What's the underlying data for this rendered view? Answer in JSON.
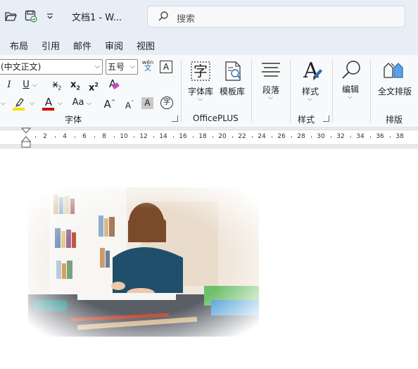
{
  "window": {
    "title": "文档1 - W...",
    "search_placeholder": "搜索"
  },
  "quick_access": [
    {
      "icon": "open-folder-icon"
    },
    {
      "icon": "save-sync-icon"
    },
    {
      "icon": "customize-dropdown-icon"
    }
  ],
  "tabs": [
    "布局",
    "引用",
    "邮件",
    "审阅",
    "视图"
  ],
  "font_group": {
    "font_name": "(中文正文)",
    "font_size": "五号",
    "phonetic_top": "wén",
    "phonetic_bottom": "文",
    "border_char": "A",
    "italic": "I",
    "underline": "U",
    "subscript": "x",
    "subscript_sub": "2",
    "superscript": "x",
    "superscript_sup": "2",
    "clear_format": "A",
    "font_color": "A",
    "change_case": "Aa",
    "grow_font": "A",
    "shrink_font": "A",
    "shading": "A",
    "enclose_char": "字",
    "label": "字体",
    "highlight_color": "#f2e400",
    "font_color_bar": "#d40000"
  },
  "officeplus_group": {
    "buttons": [
      {
        "label": "字体库",
        "icon": "font-library-icon",
        "glyph": "字"
      },
      {
        "label": "模板库",
        "icon": "template-library-icon"
      }
    ],
    "label": "OfficePLUS"
  },
  "paragraph_group": {
    "label": "段落",
    "icon": "paragraph-icon"
  },
  "styles_group": {
    "button": "样式",
    "label": "样式",
    "icon": "styles-icon",
    "glyph": "A"
  },
  "editing_group": {
    "label": "编辑",
    "icon": "editing-search-icon"
  },
  "layout_group": {
    "button": "全文排版",
    "label": "排版",
    "icon": "full-text-layout-icon"
  },
  "ruler": {
    "marks": [
      "2",
      "4",
      "6",
      "8",
      "10",
      "12",
      "14",
      "16",
      "18",
      "20",
      "22",
      "24",
      "26",
      "28",
      "30",
      "32",
      "34",
      "36",
      "38"
    ]
  },
  "document": {
    "image": "photo of a girl writing at a desk in a room with bookshelves"
  },
  "colors": {
    "chrome": "#e8eef5",
    "ribbon": "#f7f9fb",
    "accent_blue": "#2b6cb0"
  }
}
